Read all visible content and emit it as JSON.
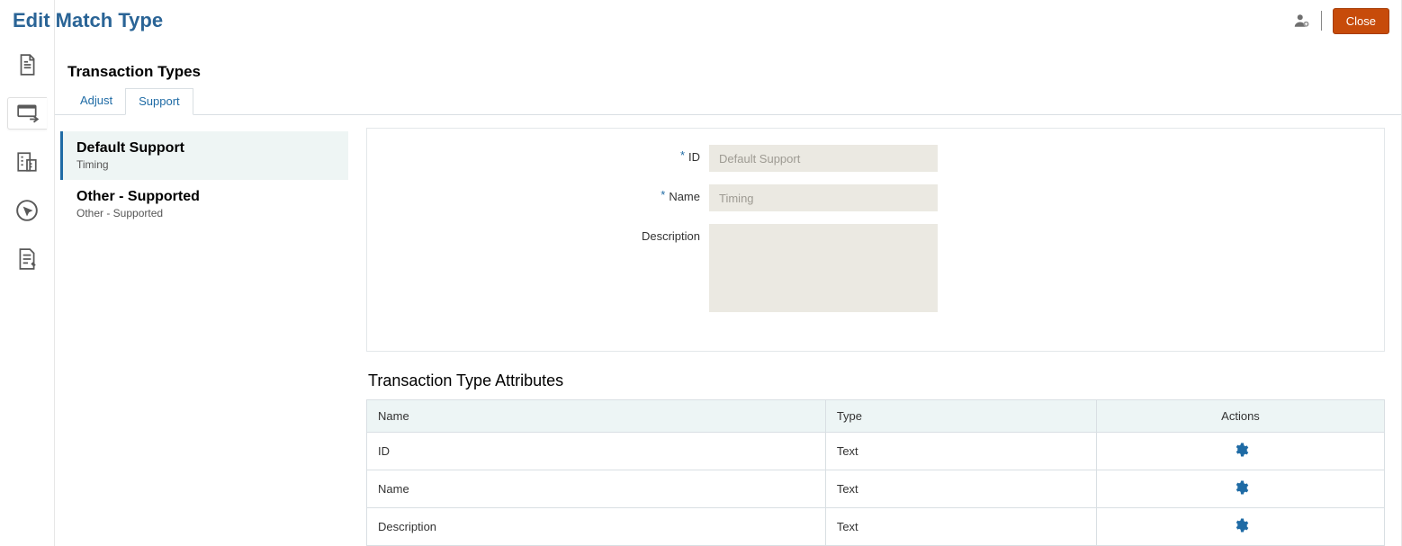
{
  "header": {
    "title": "Edit Match Type",
    "close_label": "Close"
  },
  "section": {
    "heading": "Transaction Types"
  },
  "tabs": {
    "adjust": "Adjust",
    "support": "Support"
  },
  "list": {
    "items": [
      {
        "title": "Default Support",
        "subtitle": "Timing"
      },
      {
        "title": "Other - Supported",
        "subtitle": "Other - Supported"
      }
    ]
  },
  "form": {
    "id_label": "ID",
    "id_value": "Default Support",
    "name_label": "Name",
    "name_value": "Timing",
    "desc_label": "Description",
    "desc_value": ""
  },
  "attributes": {
    "heading": "Transaction Type Attributes",
    "columns": {
      "name": "Name",
      "type": "Type",
      "actions": "Actions"
    },
    "rows": [
      {
        "name": "ID",
        "type": "Text"
      },
      {
        "name": "Name",
        "type": "Text"
      },
      {
        "name": "Description",
        "type": "Text"
      }
    ]
  }
}
